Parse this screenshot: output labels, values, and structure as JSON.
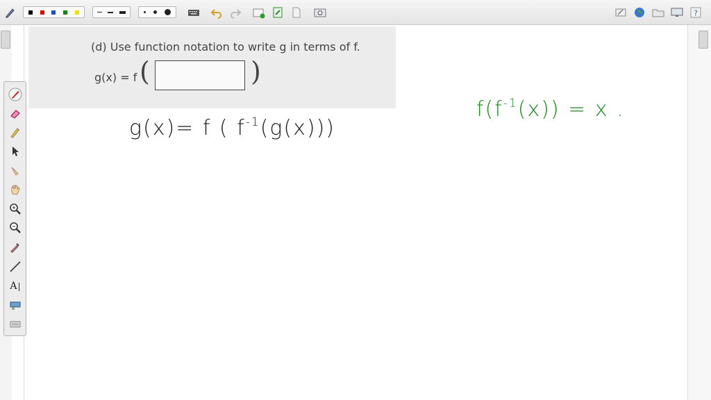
{
  "problem": {
    "instruction": "(d) Use function notation to write g in terms of f.",
    "lhs": "g(x) = f"
  },
  "handwriting": {
    "black_pre": "g(x)=  f ( f",
    "black_sup": "-1",
    "black_post": "(g(x)))",
    "green_pre": "f(f",
    "green_sup": "-1",
    "green_post": "(x)) =  x ."
  },
  "colors": {
    "toolbar_bg": "#e8e8e8",
    "ink_black": "#1a1a1a",
    "ink_green": "#1a8a1a",
    "problem_bg": "#ececec"
  },
  "toolbar": {
    "swatches": [
      "#000000",
      "#e00000",
      "#1a4fd0",
      "#118811",
      "#f5e000"
    ],
    "icons": [
      "pen-settings-icon",
      "keyboard-icon",
      "undo-icon",
      "redo-icon",
      "new-page-icon",
      "insert-icon",
      "page-icon",
      "screen-capture-icon",
      "eraser-clear-icon",
      "globe-icon",
      "folder-icon",
      "monitor-icon",
      "help-icon"
    ]
  },
  "side_tools": [
    "pen-icon",
    "eraser-icon",
    "highlighter-icon",
    "pointer-icon",
    "select-hand-icon",
    "pan-hand-icon",
    "zoom-in-icon",
    "zoom-out-icon",
    "eyedropper-icon",
    "line-icon",
    "text-tool-icon",
    "shape-icon",
    "more-icon"
  ],
  "side_tool_text": "A"
}
